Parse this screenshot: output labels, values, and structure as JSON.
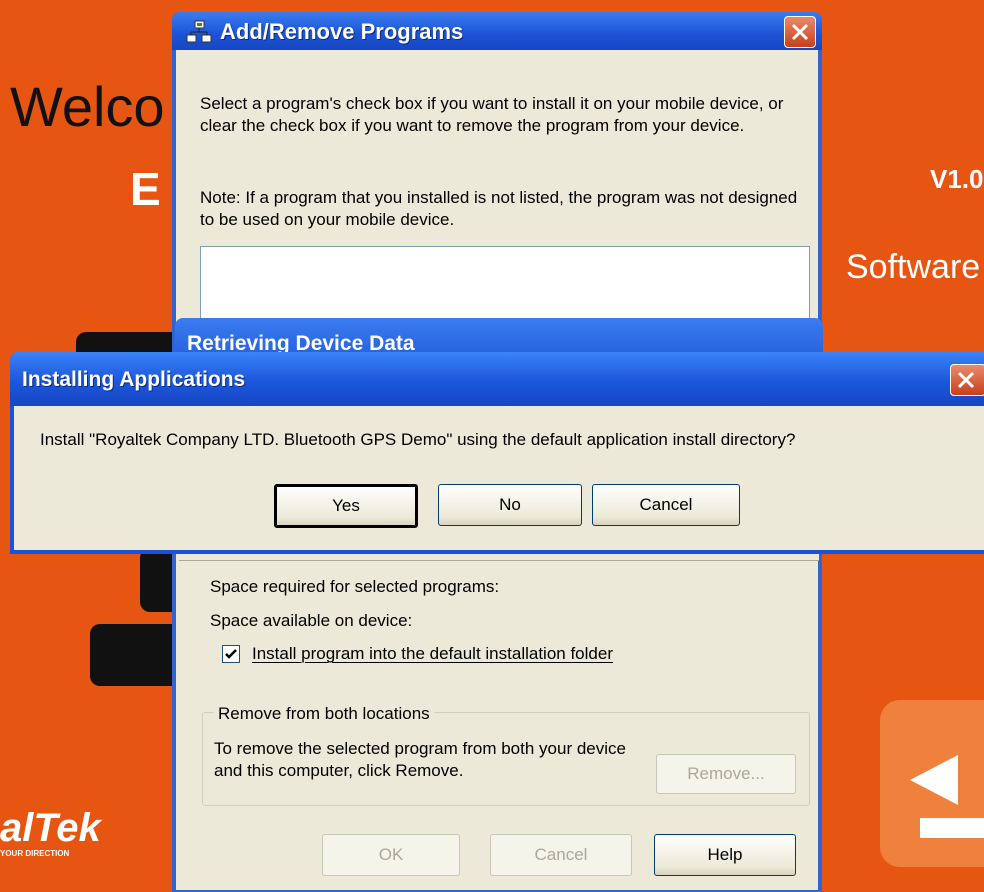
{
  "background": {
    "welcome_text": "Welco",
    "version_text": "V1.0",
    "e_text": "E",
    "software_text": "Software",
    "brand_text": "alTek",
    "brand_tagline": "YOUR DIRECTION",
    "accent_color": "#e65512"
  },
  "add_remove": {
    "title": "Add/Remove Programs",
    "instruction": "Select a program's check box if you want to install it on your mobile device, or clear the check box if you want to remove the program from your device.",
    "note": "Note:  If a program that you installed is not listed, the program was not designed to be used on your mobile device.",
    "space_required": "Space required for selected programs:",
    "space_available": "Space available on device:",
    "install_default_label": "Install program into the default installation folder",
    "install_default_checked": true,
    "remove_group_label": "Remove from both locations",
    "remove_group_text": "To remove the selected program from both your device and this computer, click Remove.",
    "remove_button": "Remove...",
    "ok_button": "OK",
    "cancel_button": "Cancel",
    "help_button": "Help"
  },
  "retrieving": {
    "title": "Retrieving Device Data"
  },
  "installing": {
    "title": "Installing Applications",
    "message": "Install \"Royaltek Company LTD. Bluetooth GPS Demo\" using the default application install directory?",
    "yes_button": "Yes",
    "no_button": "No",
    "cancel_button": "Cancel"
  }
}
